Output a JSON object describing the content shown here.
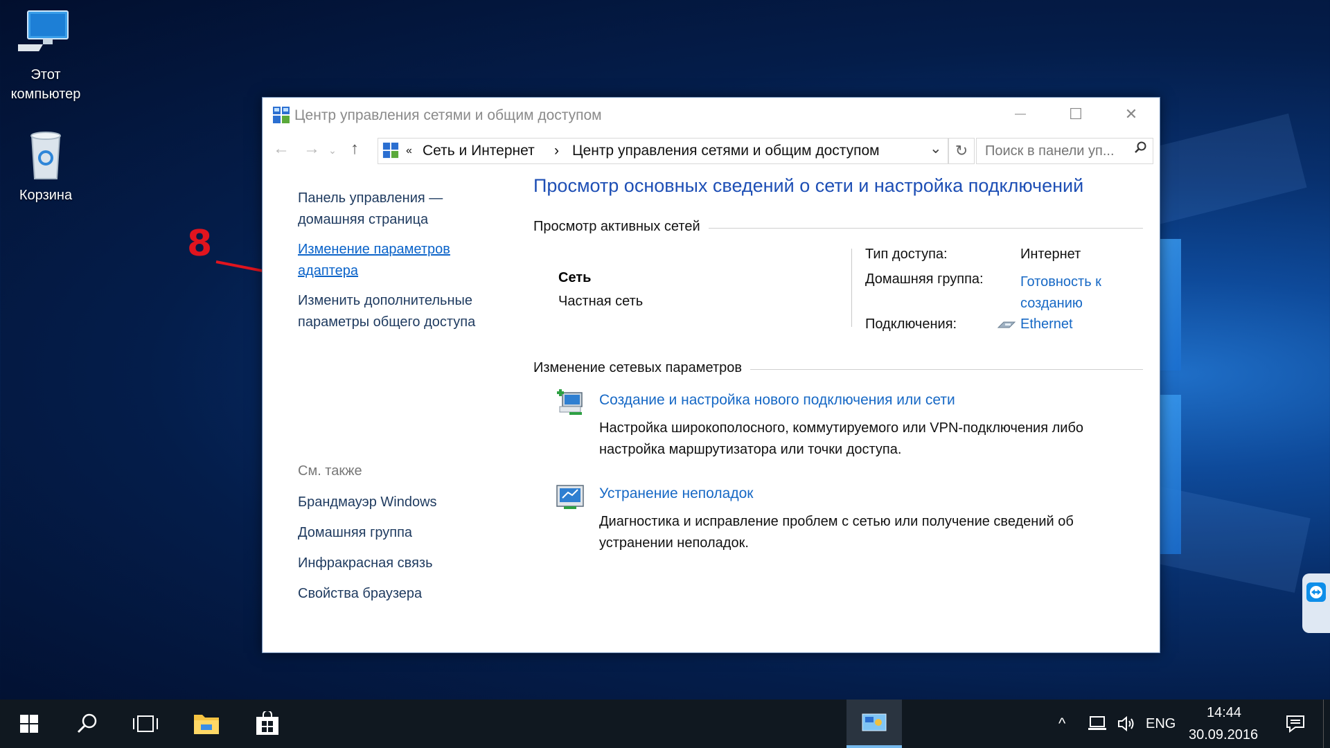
{
  "desktop": {
    "icons": [
      {
        "label_line1": "Этот",
        "label_line2": "компьютер",
        "icon": "computer-icon"
      },
      {
        "label_line1": "Корзина",
        "label_line2": "",
        "icon": "recycle-bin-icon"
      }
    ]
  },
  "window": {
    "title": "Центр управления сетями и общим доступом",
    "controls": {
      "minimize": "—",
      "maximize": "☐",
      "close": "✕"
    },
    "address": {
      "overflow": "«",
      "crumbs": [
        "Сеть и Интернет",
        "Центр управления сетями и общим доступом"
      ],
      "separator": "›",
      "dropdown": "⌄",
      "refresh": "↻"
    },
    "search": {
      "placeholder": "Поиск в панели уп..."
    }
  },
  "sidebar": {
    "home_line1": "Панель управления —",
    "home_line2": "домашняя страница",
    "adapter_line1": "Изменение параметров",
    "adapter_line2": "адаптера",
    "sharing_line1": "Изменить дополнительные",
    "sharing_line2": "параметры общего доступа",
    "see_also": "См. также",
    "see_also_items": [
      "Брандмауэр Windows",
      "Домашняя группа",
      "Инфракрасная связь",
      "Свойства браузера"
    ]
  },
  "main": {
    "title": "Просмотр основных сведений о сети и настройка подключений",
    "active_networks_heading": "Просмотр активных сетей",
    "network_name": "Сеть",
    "network_type": "Частная сеть",
    "access_type_label": "Тип доступа:",
    "access_type_value": "Интернет",
    "homegroup_label": "Домашняя группа:",
    "homegroup_value_line1": "Готовность к",
    "homegroup_value_line2": "созданию",
    "connections_label": "Подключения:",
    "connections_value": "Ethernet",
    "change_heading": "Изменение сетевых параметров",
    "task1_link": "Создание и настройка нового подключения или сети",
    "task1_desc": "Настройка широкополосного, коммутируемого или VPN-подключения либо настройка маршрутизатора или точки доступа.",
    "task2_link": "Устранение неполадок",
    "task2_desc": "Диагностика и исправление проблем с сетью или получение сведений об устранении неполадок."
  },
  "annotation": {
    "number": "8",
    "color": "#e0141e"
  },
  "taskbar": {
    "language": "ENG",
    "time": "14:44",
    "date": "30.09.2016",
    "tray_chevron": "^"
  },
  "colors": {
    "link": "#1668c5",
    "title_blue": "#1e4fb5",
    "taskbar": "#101820"
  }
}
